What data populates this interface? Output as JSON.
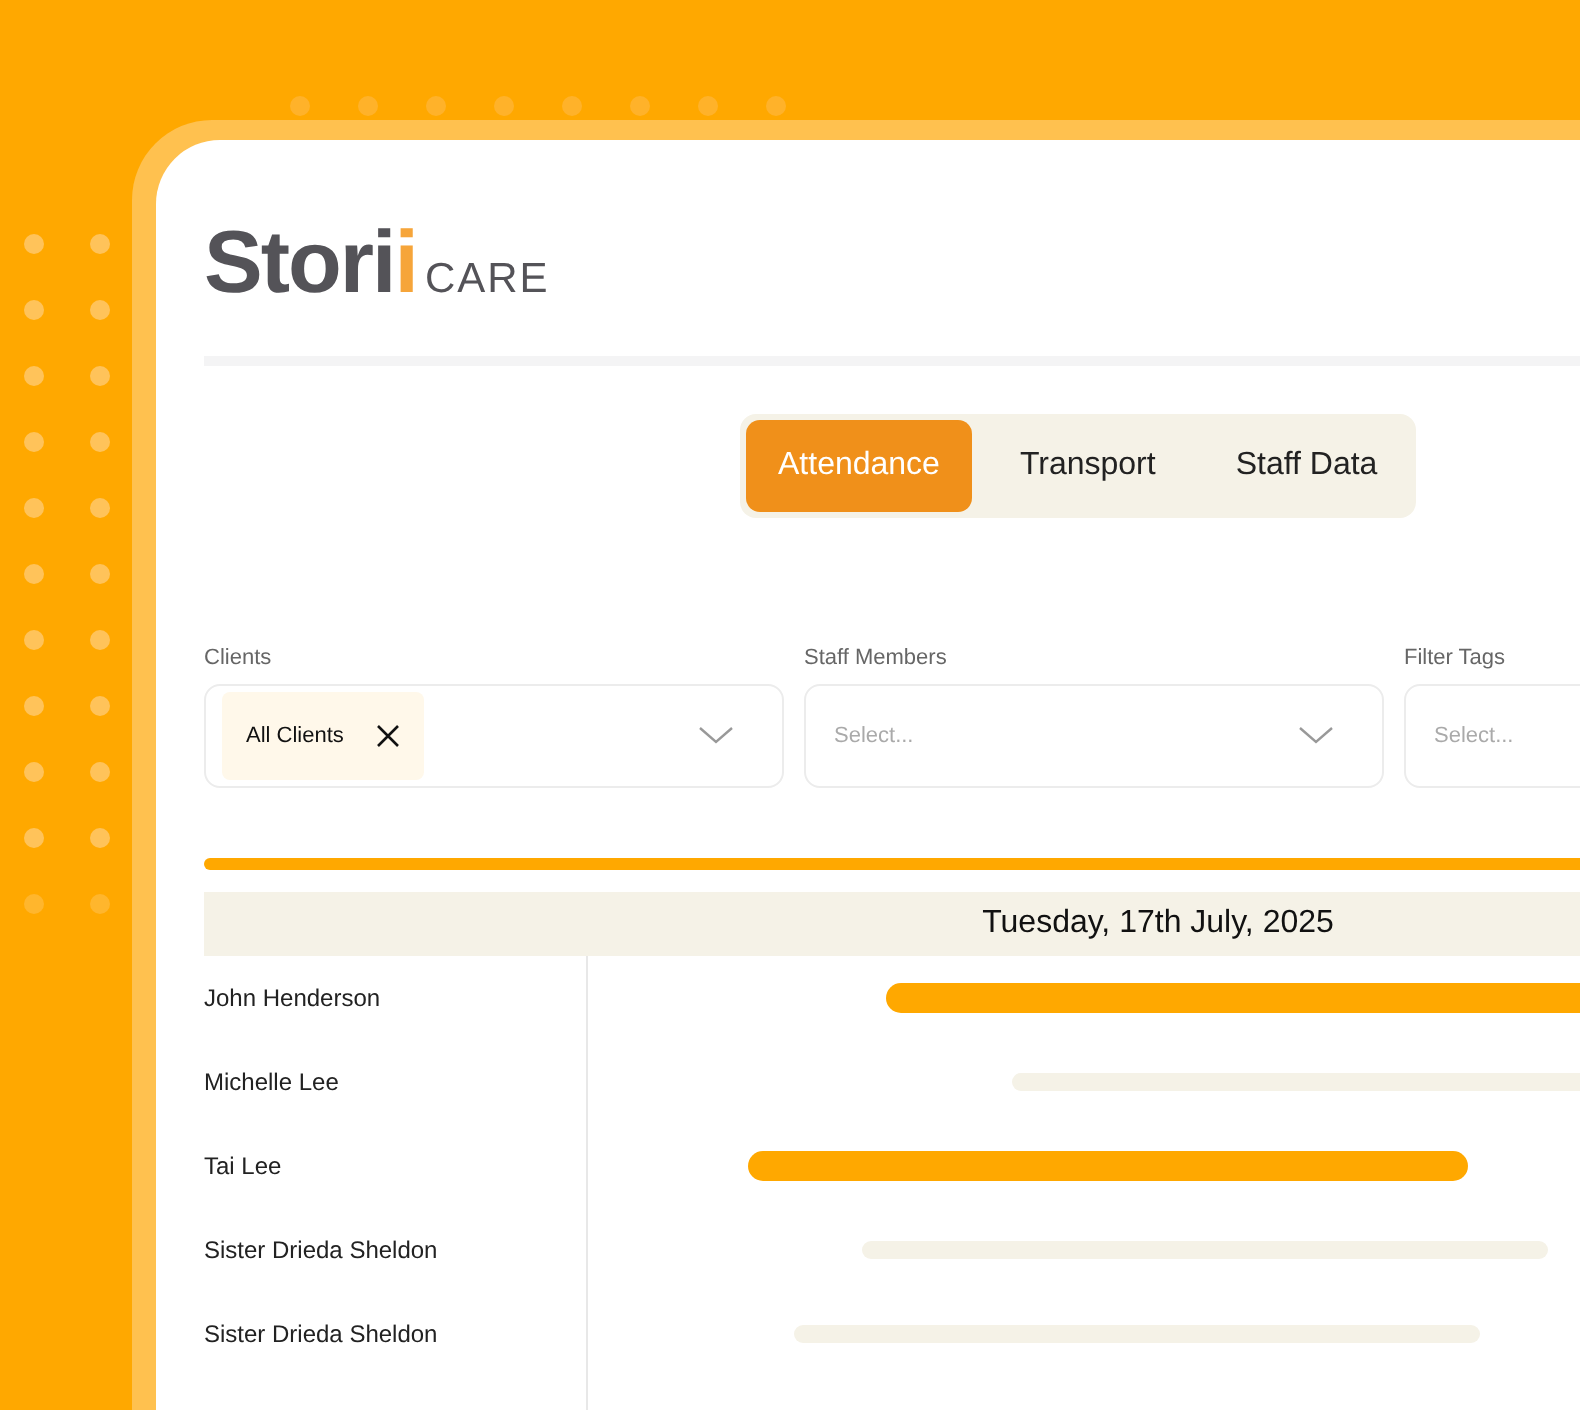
{
  "logo": {
    "word": "Stori",
    "accent": "i",
    "suffix": "CARE"
  },
  "tabs": [
    {
      "label": "Attendance",
      "selected": true
    },
    {
      "label": "Transport",
      "selected": false
    },
    {
      "label": "Staff Data",
      "selected": false
    }
  ],
  "filters": [
    {
      "label": "Clients",
      "chip": "All Clients"
    },
    {
      "label": "Staff Members",
      "placeholder": "Select..."
    },
    {
      "label": "Filter Tags",
      "placeholder": "Select..."
    }
  ],
  "schedule": {
    "date": "Tuesday, 17th July, 2025",
    "rows": [
      {
        "name": "John Henderson",
        "kind": "attended"
      },
      {
        "name": "Michelle Lee",
        "kind": "planned"
      },
      {
        "name": "Tai Lee",
        "kind": "attended"
      },
      {
        "name": "Sister  Drieda Sheldon",
        "kind": "planned"
      },
      {
        "name": "Sister  Drieda Sheldon",
        "kind": "planned"
      }
    ]
  }
}
